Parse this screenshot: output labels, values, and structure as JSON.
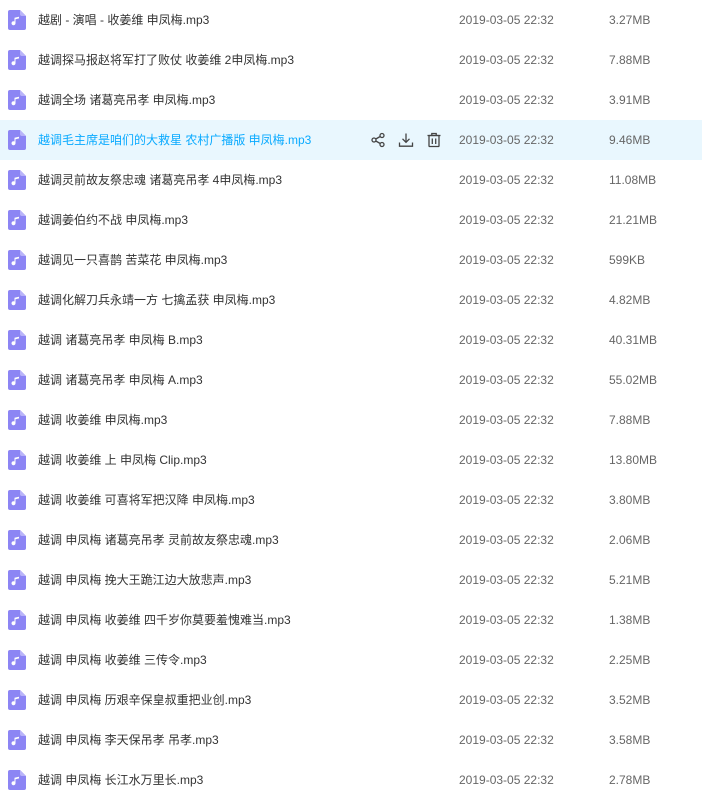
{
  "colors": {
    "icon_bg": "#8c85f4",
    "hover_bg": "#e9f7fe",
    "hover_text": "#09aaff",
    "text": "#333333",
    "meta_text": "#666666"
  },
  "hovered_row": 3,
  "row_icon": "music-file-icon",
  "hover_actions": [
    "share-icon",
    "download-icon",
    "delete-icon"
  ],
  "files": [
    {
      "name": "越剧 - 演唱 - 收姜维 申凤梅.mp3",
      "date": "2019-03-05 22:32",
      "size": "3.27MB"
    },
    {
      "name": "越调探马报赵将军打了败仗 收姜维 2申凤梅.mp3",
      "date": "2019-03-05 22:32",
      "size": "7.88MB"
    },
    {
      "name": "越调全场 诸葛亮吊孝 申凤梅.mp3",
      "date": "2019-03-05 22:32",
      "size": "3.91MB"
    },
    {
      "name": "越调毛主席是咱们的大救星 农村广播版 申凤梅.mp3",
      "date": "2019-03-05 22:32",
      "size": "9.46MB"
    },
    {
      "name": "越调灵前故友祭忠魂 诸葛亮吊孝 4申凤梅.mp3",
      "date": "2019-03-05 22:32",
      "size": "11.08MB"
    },
    {
      "name": "越调姜伯约不战 申凤梅.mp3",
      "date": "2019-03-05 22:32",
      "size": "21.21MB"
    },
    {
      "name": "越调见一只喜鹊 苦菜花 申凤梅.mp3",
      "date": "2019-03-05 22:32",
      "size": "599KB"
    },
    {
      "name": "越调化解刀兵永靖一方 七擒孟获 申凤梅.mp3",
      "date": "2019-03-05 22:32",
      "size": "4.82MB"
    },
    {
      "name": "越调 诸葛亮吊孝 申凤梅 B.mp3",
      "date": "2019-03-05 22:32",
      "size": "40.31MB"
    },
    {
      "name": "越调 诸葛亮吊孝 申凤梅 A.mp3",
      "date": "2019-03-05 22:32",
      "size": "55.02MB"
    },
    {
      "name": "越调 收姜维 申凤梅.mp3",
      "date": "2019-03-05 22:32",
      "size": "7.88MB"
    },
    {
      "name": "越调 收姜维 上 申凤梅 Clip.mp3",
      "date": "2019-03-05 22:32",
      "size": "13.80MB"
    },
    {
      "name": "越调 收姜维 可喜将军把汉降 申凤梅.mp3",
      "date": "2019-03-05 22:32",
      "size": "3.80MB"
    },
    {
      "name": "越调 申凤梅 诸葛亮吊孝 灵前故友祭忠魂.mp3",
      "date": "2019-03-05 22:32",
      "size": "2.06MB"
    },
    {
      "name": "越调 申凤梅 挽大王跪江边大放悲声.mp3",
      "date": "2019-03-05 22:32",
      "size": "5.21MB"
    },
    {
      "name": "越调 申凤梅 收姜维 四千岁你莫要羞愧难当.mp3",
      "date": "2019-03-05 22:32",
      "size": "1.38MB"
    },
    {
      "name": "越调 申凤梅 收姜维 三传令.mp3",
      "date": "2019-03-05 22:32",
      "size": "2.25MB"
    },
    {
      "name": "越调 申凤梅 历艰辛保皇叔重把业创.mp3",
      "date": "2019-03-05 22:32",
      "size": "3.52MB"
    },
    {
      "name": "越调 申凤梅 李天保吊孝 吊孝.mp3",
      "date": "2019-03-05 22:32",
      "size": "3.58MB"
    },
    {
      "name": "越调 申凤梅 长江水万里长.mp3",
      "date": "2019-03-05 22:32",
      "size": "2.78MB"
    }
  ]
}
